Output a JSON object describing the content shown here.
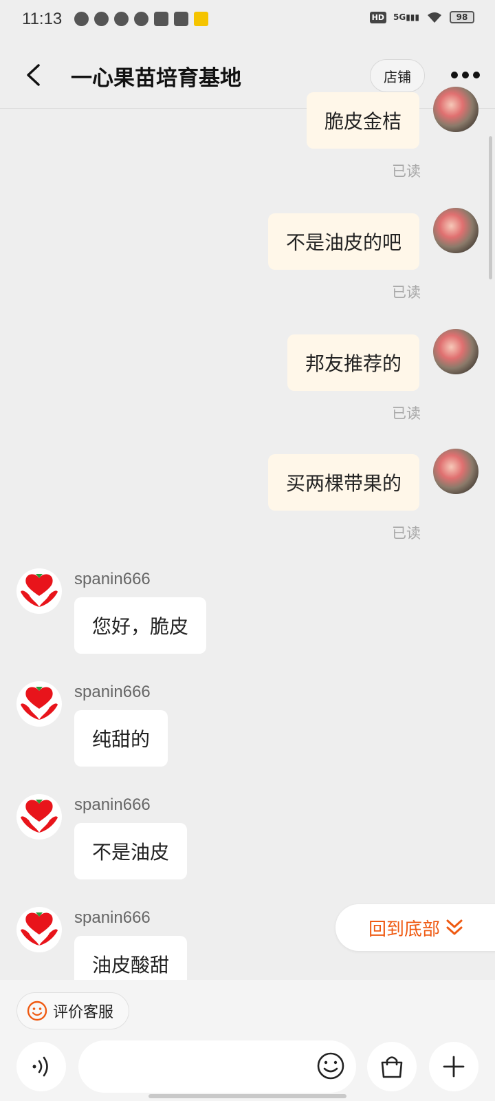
{
  "status_bar": {
    "time": "11:13",
    "hd": "HD",
    "network": "5G",
    "battery": "98"
  },
  "header": {
    "title": "一心果苗培育基地",
    "store_button": "店铺"
  },
  "outgoing": [
    {
      "text": "脆皮金桔",
      "status": "已读"
    },
    {
      "text": "不是油皮的吧",
      "status": "已读"
    },
    {
      "text": "邦友推荐的",
      "status": "已读"
    },
    {
      "text": "买两棵带果的",
      "status": "已读"
    }
  ],
  "incoming": [
    {
      "sender": "spanin666",
      "text": "您好，脆皮"
    },
    {
      "sender": "spanin666",
      "text": "纯甜的"
    },
    {
      "sender": "spanin666",
      "text": "不是油皮"
    },
    {
      "sender": "spanin666",
      "text": "油皮酸甜"
    }
  ],
  "back_to_bottom": "回到底部",
  "bottom_bar": {
    "rate_label": "评价客服",
    "input_placeholder": ""
  },
  "colors": {
    "accent": "#ef5a12",
    "outgoing_bubble": "#fff7e9",
    "background": "#eeeeee"
  },
  "icons": [
    "back-arrow-icon",
    "more-dots-icon",
    "smile-icon",
    "voice-icon",
    "emoji-icon",
    "shopping-bag-icon",
    "plus-icon",
    "chevron-double-down-icon"
  ]
}
